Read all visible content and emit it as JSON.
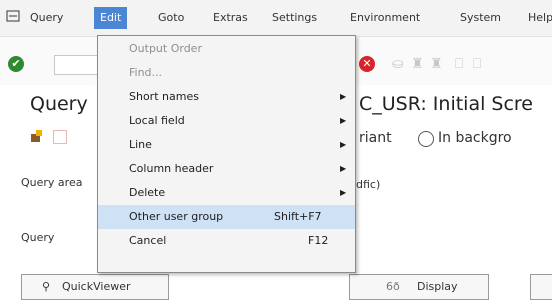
{
  "menubar": {
    "items": [
      "Query",
      "Edit",
      "Goto",
      "Extras",
      "Settings",
      "Environment",
      "System",
      "Help"
    ]
  },
  "title": {
    "left": "Query",
    "right": "C_USR: Initial Scre"
  },
  "app_toolbar": {
    "variant_text": "riant",
    "background_text": "In backgro"
  },
  "fields": {
    "query_area_label": "Query area",
    "query_area_value": "dfic)",
    "query_label": "Query"
  },
  "buttons": {
    "quickviewer": "QuickViewer",
    "display": "Display",
    "display_icon": "6ð"
  },
  "edit_menu": [
    {
      "label": "Output Order",
      "shortcut": "",
      "submenu": false,
      "disabled": true
    },
    {
      "label": "Find...",
      "shortcut": "",
      "submenu": false,
      "disabled": true
    },
    {
      "label": "Short names",
      "shortcut": "",
      "submenu": true,
      "disabled": false
    },
    {
      "label": "Local field",
      "shortcut": "",
      "submenu": true,
      "disabled": false
    },
    {
      "label": "Line",
      "shortcut": "",
      "submenu": true,
      "disabled": false
    },
    {
      "label": "Column header",
      "shortcut": "",
      "submenu": true,
      "disabled": false
    },
    {
      "label": "Delete",
      "shortcut": "",
      "submenu": true,
      "disabled": false
    },
    {
      "label": "Other user group",
      "shortcut": "Shift+F7",
      "submenu": false,
      "disabled": false
    },
    {
      "label": "Cancel",
      "shortcut": "F12",
      "submenu": false,
      "disabled": false
    }
  ],
  "colors": {
    "menu_active": "#4a86d4",
    "menu_hover": "#cfe1f5",
    "ok_green": "#2f8a2f",
    "cancel_red": "#d8232a"
  }
}
